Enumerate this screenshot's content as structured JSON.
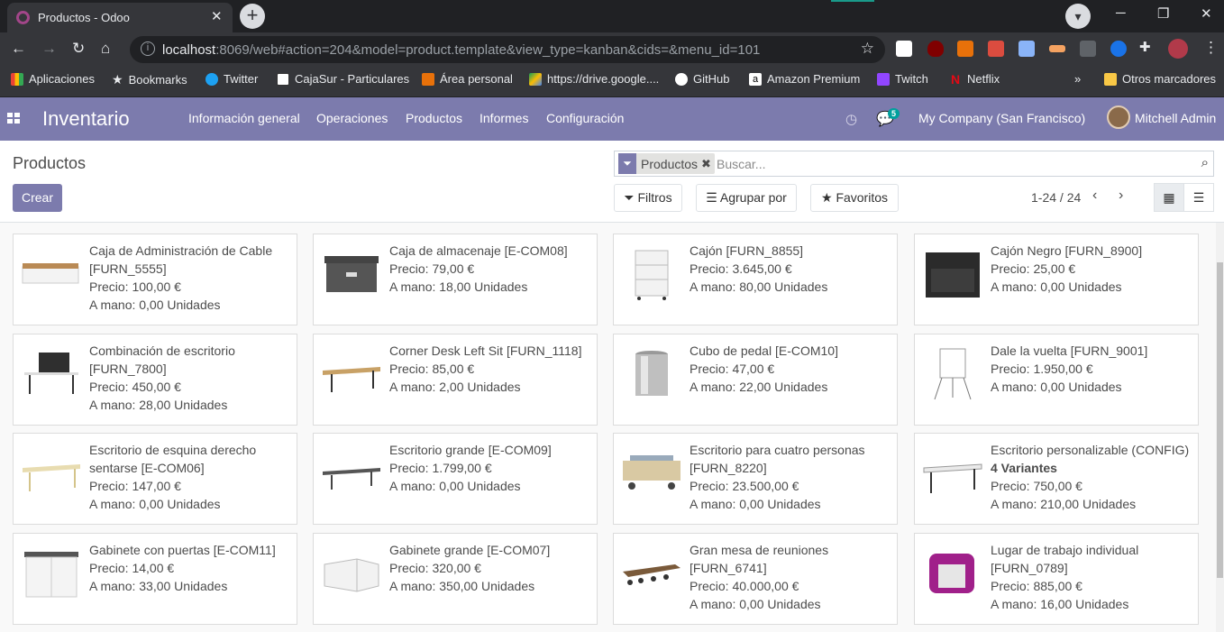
{
  "browser": {
    "tab_title": "Productos - Odoo",
    "tab_close": "✕",
    "new_tab": "+",
    "url_host": "localhost",
    "url_rest": ":8069/web#action=204&model=product.template&view_type=kanban&cids=&menu_id=101",
    "bookmarks": [
      "Aplicaciones",
      "Bookmarks",
      "Twitter",
      "CajaSur - Particulares",
      "Área personal",
      "https://drive.google....",
      "GitHub",
      "Amazon Premium",
      "Twitch",
      "Netflix"
    ],
    "more_bookmarks": "»",
    "other_bookmarks": "Otros marcadores"
  },
  "navbar": {
    "app_name": "Inventario",
    "menus": [
      "Información general",
      "Operaciones",
      "Productos",
      "Informes",
      "Configuración"
    ],
    "chat_badge": "5",
    "company": "My Company (San Francisco)",
    "user": "Mitchell Admin"
  },
  "control_panel": {
    "breadcrumb": "Productos",
    "create_label": "Crear",
    "facet_label": "Productos",
    "search_placeholder": "Buscar...",
    "filters_label": "Filtros",
    "groupby_label": "Agrupar por",
    "favorites_label": "Favoritos",
    "pager": "1-24 / 24"
  },
  "colors": {
    "brand": "#7c7bad",
    "accent": "#00a09d"
  },
  "products": [
    {
      "name": "Caja de Administración de Cable [FURN_5555]",
      "variants": "",
      "price": "Precio: 100,00 €",
      "onhand": "A mano: 0,00 Unidades",
      "icon": "cable-box"
    },
    {
      "name": "Caja de almacenaje [E-COM08]",
      "variants": "",
      "price": "Precio: 79,00 €",
      "onhand": "A mano: 18,00 Unidades",
      "icon": "storage-box"
    },
    {
      "name": "Cajón [FURN_8855]",
      "variants": "",
      "price": "Precio: 3.645,00 €",
      "onhand": "A mano: 80,00 Unidades",
      "icon": "drawer-white"
    },
    {
      "name": "Cajón Negro [FURN_8900]",
      "variants": "",
      "price": "Precio: 25,00 €",
      "onhand": "A mano: 0,00 Unidades",
      "icon": "drawer-black"
    },
    {
      "name": "Combinación de escritorio [FURN_7800]",
      "variants": "",
      "price": "Precio: 450,00 €",
      "onhand": "A mano: 28,00 Unidades",
      "icon": "desk-combo"
    },
    {
      "name": "Corner Desk Left Sit [FURN_1118]",
      "variants": "",
      "price": "Precio: 85,00 €",
      "onhand": "A mano: 2,00 Unidades",
      "icon": "corner-desk"
    },
    {
      "name": "Cubo de pedal [E-COM10]",
      "variants": "",
      "price": "Precio: 47,00 €",
      "onhand": "A mano: 22,00 Unidades",
      "icon": "pedal-bin"
    },
    {
      "name": "Dale la vuelta [FURN_9001]",
      "variants": "",
      "price": "Precio: 1.950,00 €",
      "onhand": "A mano: 0,00 Unidades",
      "icon": "flipchart"
    },
    {
      "name": "Escritorio de esquina derecho sentarse [E-COM06]",
      "variants": "",
      "price": "Precio: 147,00 €",
      "onhand": "A mano: 0,00 Unidades",
      "icon": "corner-desk-right"
    },
    {
      "name": "Escritorio grande [E-COM09]",
      "variants": "",
      "price": "Precio: 1.799,00 €",
      "onhand": "A mano: 0,00 Unidades",
      "icon": "large-desk"
    },
    {
      "name": "Escritorio para cuatro personas [FURN_8220]",
      "variants": "",
      "price": "Precio: 23.500,00 €",
      "onhand": "A mano: 0,00 Unidades",
      "icon": "four-person-desk"
    },
    {
      "name": "Escritorio personalizable (CONFIG)",
      "variants": "4 Variantes",
      "price": "Precio: 750,00 €",
      "onhand": "A mano: 210,00 Unidades",
      "icon": "custom-desk"
    },
    {
      "name": "Gabinete con puertas [E-COM11]",
      "variants": "",
      "price": "Precio: 14,00 €",
      "onhand": "A mano: 33,00 Unidades",
      "icon": "cabinet-doors"
    },
    {
      "name": "Gabinete grande [E-COM07]",
      "variants": "",
      "price": "Precio: 320,00 €",
      "onhand": "A mano: 350,00 Unidades",
      "icon": "large-cabinet"
    },
    {
      "name": "Gran mesa de reuniones [FURN_6741]",
      "variants": "",
      "price": "Precio: 40.000,00 €",
      "onhand": "A mano: 0,00 Unidades",
      "icon": "meeting-table"
    },
    {
      "name": "Lugar de trabajo individual [FURN_0789]",
      "variants": "",
      "price": "Precio: 885,00 €",
      "onhand": "A mano: 16,00 Unidades",
      "icon": "workpod"
    }
  ]
}
